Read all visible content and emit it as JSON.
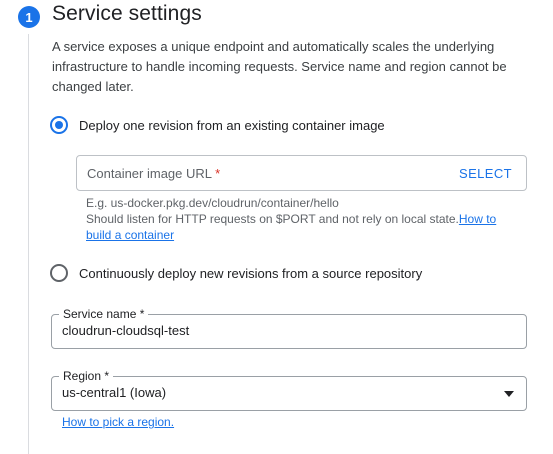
{
  "step": {
    "number": "1",
    "title": "Service settings"
  },
  "description": "A service exposes a unique endpoint and automatically scales the underlying infrastructure to handle incoming requests. Service name and region cannot be changed later.",
  "deploy_options": {
    "existing_image": {
      "label": "Deploy one revision from an existing container image",
      "selected": true
    },
    "source_repo": {
      "label": "Continuously deploy new revisions from a source repository",
      "selected": false
    }
  },
  "container_image": {
    "placeholder": "Container image URL",
    "required_mark": "*",
    "value": "",
    "select_label": "SELECT",
    "hint_example": "E.g. us-docker.pkg.dev/cloudrun/container/hello",
    "hint_text": "Should listen for HTTP requests on $PORT and not rely on local state.",
    "hint_link": "How to build a container"
  },
  "service_name": {
    "label": "Service name *",
    "value": "cloudrun-cloudsql-test"
  },
  "region": {
    "label": "Region *",
    "value": "us-central1 (Iowa)",
    "help_link": "How to pick a region."
  },
  "colors": {
    "accent": "#1a73e8",
    "required": "#d93025",
    "text": "#202124",
    "secondary_text": "#5f6368"
  },
  "icons": {
    "dropdown": "chevron-down-icon"
  }
}
